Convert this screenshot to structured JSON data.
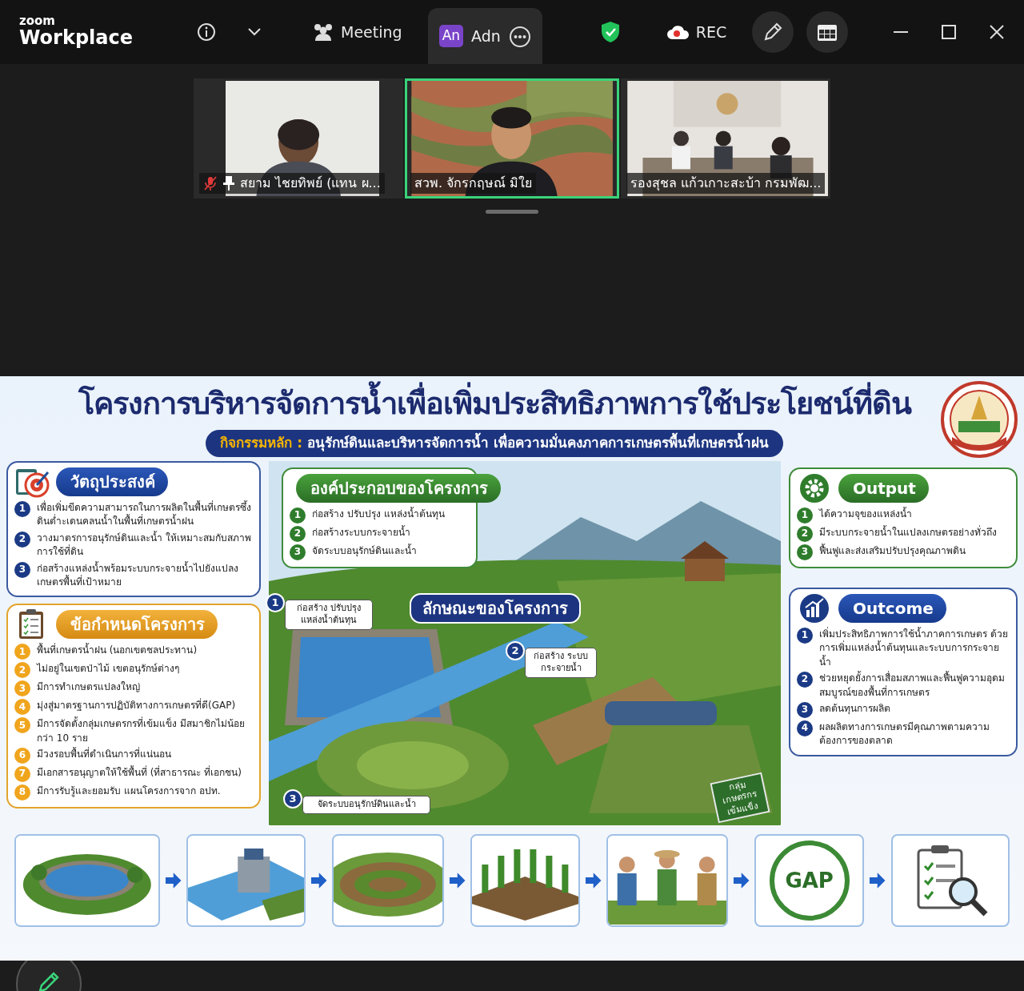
{
  "app": {
    "brand_top": "zoom",
    "brand_bottom": "Workplace"
  },
  "toolbar": {
    "meeting_label": "Meeting",
    "tab": {
      "avatar": "An",
      "label": "Adn",
      "selected": true
    },
    "rec_label": "REC"
  },
  "participants": [
    {
      "name": "สยาม ไชยทิพย์ (แทน ผ...",
      "muted": true,
      "pinned": true,
      "speaking": false
    },
    {
      "name": "สวพ. จักรกฤษณ์ มิใย",
      "muted": false,
      "pinned": false,
      "speaking": true
    },
    {
      "name": "รองสุชล แก้วเกาะสะบ้า กรมพัฒ...",
      "muted": false,
      "pinned": false,
      "speaking": false
    }
  ],
  "slide": {
    "title": "โครงการบริหารจัดการน้ำเพื่อเพิ่มประสิทธิภาพการใช้ประโยชน์ที่ดิน",
    "subtitle_label": "กิจกรรมหลัก :",
    "subtitle": "อนุรักษ์ดินและบริหารจัดการน้ำ เพื่อความมั่นคงภาคการเกษตรพื้นที่เกษตรน้ำฝน",
    "objectives": {
      "heading": "วัตถุประสงค์",
      "items": [
        {
          "number": "1",
          "text": "เพื่อเพิ่มขีดความสามารถในการผลิตในพื้นที่เกษตรซึ้งดินต่ำะเดนคลนน้ำในพื้นที่เกษตรน้ำฝน"
        },
        {
          "number": "2",
          "text": "วางมาตรการอนุรักษ์ดินและน้ำ ให้เหมาะสมกับสภาพการใช้ที่ดิน"
        },
        {
          "number": "3",
          "text": "ก่อสร้างแหล่งน้ำพร้อมระบบกระจายน้ำไปยังแปลงเกษตรพื้นที่เป้าหมาย"
        }
      ]
    },
    "requirements": {
      "heading": "ข้อกำหนดโครงการ",
      "items": [
        {
          "number": "1",
          "text": "พื้นที่เกษตรน้ำฝน (นอกเขตชลประทาน)"
        },
        {
          "number": "2",
          "text": "ไม่อยู่ในเขตป่าไม้ เขตอนุรักษ์ต่างๆ"
        },
        {
          "number": "3",
          "text": "มีการทำเกษตรแปลงใหญ่"
        },
        {
          "number": "4",
          "text": "มุ่งสู่มาตรฐานการปฏิบัติทางการเกษตรที่ดี(GAP)"
        },
        {
          "number": "5",
          "text": "มีการจัดตั้งกลุ่มเกษตรกรที่เข้มแข็ง มีสมาชิกไม่น้อยกว่า 10 ราย"
        },
        {
          "number": "6",
          "text": "มีวงรอบพื้นที่ดำเนินการที่แน่นอน"
        },
        {
          "number": "7",
          "text": "มีเอกสารอนุญาตให้ใช้พื้นที่ (ที่สาธารณะ ที่เอกชน)"
        },
        {
          "number": "8",
          "text": "มีการรับรู้และยอมรับ แผนโครงการจาก อปท."
        }
      ]
    },
    "components": {
      "heading": "องค์ประกอบของโครงการ",
      "items": [
        {
          "number": "1",
          "text": "ก่อสร้าง ปรับปรุง แหล่งน้ำต้นทุน"
        },
        {
          "number": "2",
          "text": "ก่อสร้างระบบกระจายน้ำ"
        },
        {
          "number": "3",
          "text": "จัดระบบอนุรักษ์ดินและน้ำ"
        }
      ]
    },
    "features_heading": "ลักษณะของโครงการ",
    "callouts": [
      {
        "number": "1",
        "text": "ก่อสร้าง ปรับปรุง แหล่งน้ำต้นทุน"
      },
      {
        "number": "2",
        "text": "ก่อสร้าง ระบบกระจายน้ำ"
      },
      {
        "number": "3",
        "text": "จัดระบบอนุรักษ์ดินและน้ำ"
      }
    ],
    "sign": "กลุ่มเกษตรกร เข้มแข็ง",
    "output": {
      "heading": "Output",
      "items": [
        {
          "number": "1",
          "text": "ได้ความจุของแหล่งน้ำ"
        },
        {
          "number": "2",
          "text": "มีระบบกระจายน้ำในแปลงเกษตรอย่างทั่วถึง"
        },
        {
          "number": "3",
          "text": "ฟื้นฟูและส่งเสริมปรับปรุงคุณภาพดิน"
        }
      ]
    },
    "outcome": {
      "heading": "Outcome",
      "items": [
        {
          "number": "1",
          "text": "เพิ่มประสิทธิภาพการใช้น้ำภาคการเกษตร ด้วยการเพิ่มแหล่งน้ำต้นทุนและระบบการกระจายน้ำ"
        },
        {
          "number": "2",
          "text": "ช่วยหยุดยั้งการเสื่อมสภาพและฟื้นฟูความอุดมสมบูรณ์ของพื้นที่การเกษตร"
        },
        {
          "number": "3",
          "text": "ลดต้นทุนการผลิต"
        },
        {
          "number": "4",
          "text": "ผลผลิตทางการเกษตรมีคุณภาพตามความต้องการของตลาด"
        }
      ]
    },
    "steps": [
      {
        "kind": "picture"
      },
      {
        "kind": "picture"
      },
      {
        "kind": "picture"
      },
      {
        "kind": "picture"
      },
      {
        "kind": "picture"
      },
      {
        "kind": "logo",
        "text": "GAP"
      },
      {
        "kind": "checklist"
      }
    ]
  }
}
